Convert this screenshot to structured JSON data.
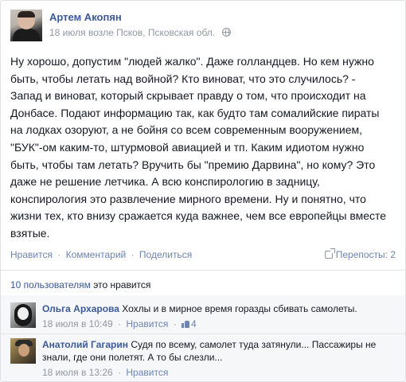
{
  "post": {
    "author": "Артем Акопян",
    "meta": "18 июля возле Псков, Псковская обл.",
    "privacy_icon": "globe-icon",
    "text_lines": [
      "Ну хорошо, допустим \"людей жалко\". Даже голландцев. Но кем нужно",
      "быть, чтобы летать над войной? Кто виноват, что это случилось? -",
      "Запад и виноват, который скрывает правду о том, что происходит на",
      "Донбасе. Подают информацию так, как будто там сомалийские пираты",
      "на лодках озоруют, а не бойня со всем современным вооружением,",
      "\"БУК\"-ом каким-то, штурмовой авиацией и тп. Каким идиотом нужно",
      "быть, чтобы там летать? Вручить бы \"премию Дарвина\", но кому? Это",
      "даже не решение летчика. А всю конспирологию в задницу,",
      "конспирология это развлечение мирного времени. Ну и понятно, что",
      "жизни тех, кто внизу сражается куда важнее, чем все европейцы вместе",
      "взятые."
    ]
  },
  "actions": {
    "like": "Нравится",
    "comment": "Комментарий",
    "share": "Поделиться",
    "separator": "·",
    "shares_count": "Перепосты: 2"
  },
  "likes_summary": {
    "count_link": "10 пользователям",
    "suffix": " это нравится"
  },
  "comments": [
    {
      "author": "Ольга Архарова",
      "text": "Хохлы и в мирное время горазды сбивать самолеты.",
      "time": "18 июля в 10:49",
      "like": "Нравится",
      "likes": "4"
    },
    {
      "author": "Анатолий Гагарин",
      "text": "Судя по всему, самолет туда затянули... Пассажиры не знали, где они полетят. А то бы слезли...",
      "time": "18 июля в 13:26",
      "like": "Нравится"
    }
  ]
}
